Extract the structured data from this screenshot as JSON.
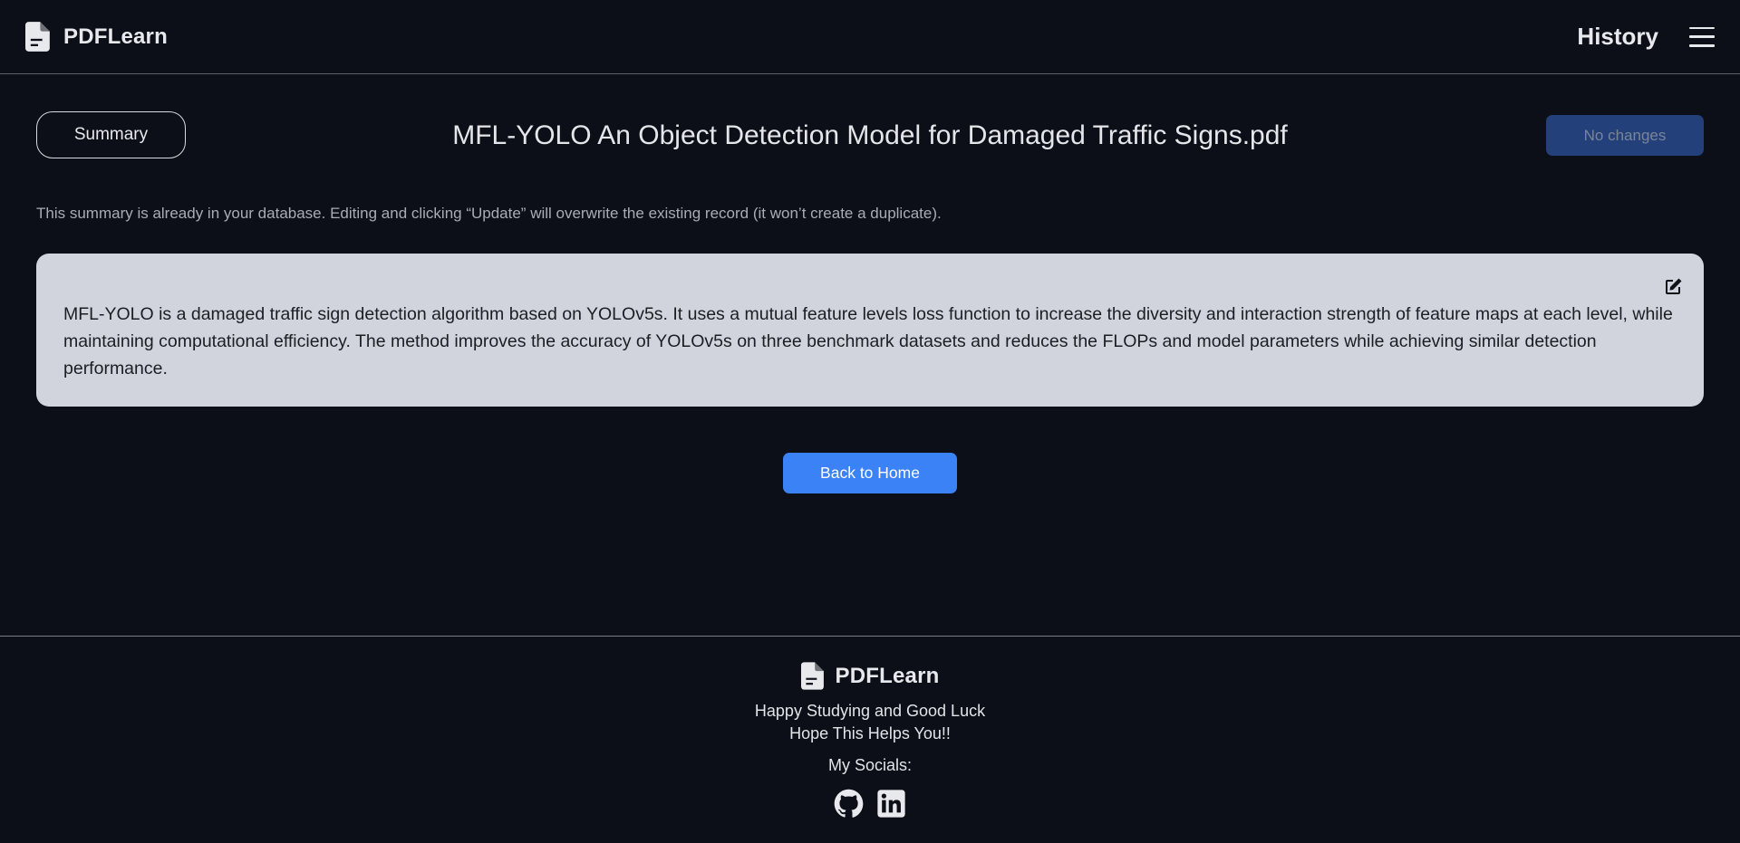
{
  "header": {
    "brand_name": "PDFLearn",
    "history_label": "History"
  },
  "toolbar": {
    "mode_label": "Summary",
    "document_title": "MFL-YOLO An Object Detection Model for Damaged Traffic Signs.pdf",
    "save_label": "No changes"
  },
  "notice": "This summary is already in your database. Editing and clicking “Update” will overwrite the existing record (it won’t create a duplicate).",
  "summary": {
    "text": "MFL-YOLO is a damaged traffic sign detection algorithm based on YOLOv5s. It uses a mutual feature levels loss function to increase the diversity and interaction strength of feature maps at each level, while maintaining computational efficiency. The method improves the accuracy of YOLOv5s on three benchmark datasets and reduces the FLOPs and model parameters while achieving similar detection performance."
  },
  "actions": {
    "back_home_label": "Back to Home"
  },
  "footer": {
    "brand_name": "PDFLearn",
    "tagline_1": "Happy Studying and Good Luck",
    "tagline_2": "Hope This Helps You!!",
    "socials_label": "My Socials:",
    "socials": [
      {
        "icon": "github-icon"
      },
      {
        "icon": "linkedin-icon"
      }
    ]
  },
  "colors": {
    "background": "#0c0f17",
    "card": "#d1d4dc",
    "accent": "#3b82f6",
    "disabled_button": "#23407a"
  }
}
